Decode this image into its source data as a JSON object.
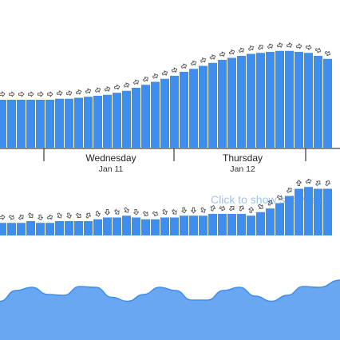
{
  "colors": {
    "bar": "#3d8eef",
    "link": "#9ec4ea",
    "arrow": "#555555",
    "axis": "#111111",
    "tide_fill": "#6aa7f2",
    "tide_line": "#3d8eef"
  },
  "icons": {
    "swell_direction": "arrow-right-icon"
  },
  "timeline": {
    "days": [
      {
        "name": "Wednesday",
        "date": "Jan 11"
      },
      {
        "name": "Thursday",
        "date": "Jan 12"
      }
    ]
  },
  "subswell_link": {
    "label": "Click to show subswells"
  },
  "chart_data": [
    {
      "type": "bar",
      "name": "primary-swell",
      "x_start": 0,
      "x_step": 1,
      "ylim": [
        0,
        120
      ],
      "values": [
        48,
        48,
        48,
        48,
        48,
        48,
        49,
        49,
        50,
        51,
        52,
        53,
        55,
        57,
        60,
        63,
        66,
        69,
        72,
        76,
        79,
        82,
        85,
        88,
        90,
        92,
        94,
        95,
        96,
        97,
        97,
        96,
        95,
        92,
        89
      ],
      "directions": [
        -8,
        -5,
        -3,
        -2,
        0,
        0,
        -12,
        -15,
        -20,
        -25,
        -28,
        -20,
        -15,
        -22,
        -30,
        -35,
        -30,
        -22,
        -18,
        -25,
        -28,
        -30,
        -25,
        -20,
        -25,
        -30,
        -35,
        -40,
        -30,
        -20,
        -15,
        -10,
        10,
        20,
        25
      ]
    },
    {
      "type": "bar",
      "name": "secondary-swell",
      "x_start": 0,
      "x_step": 1,
      "ylim": [
        0,
        40
      ],
      "values": [
        7,
        7,
        7,
        8,
        7,
        7,
        8,
        8,
        8,
        8,
        9,
        10,
        10,
        11,
        10,
        9,
        9,
        10,
        10,
        11,
        11,
        11,
        12,
        12,
        12,
        12,
        11,
        13,
        15,
        18,
        22,
        26,
        27,
        26,
        26
      ],
      "directions": [
        -10,
        30,
        -40,
        50,
        80,
        -20,
        60,
        70,
        40,
        -60,
        70,
        90,
        50,
        60,
        80,
        40,
        30,
        60,
        50,
        80,
        90,
        60,
        -70,
        20,
        -45,
        -60,
        -80,
        40,
        -60,
        30,
        -40,
        -90,
        -20,
        -50,
        -60
      ]
    },
    {
      "type": "area",
      "name": "tide",
      "ylim": [
        0,
        1
      ],
      "x": [
        0,
        20,
        40,
        60,
        80,
        100,
        120,
        140,
        160,
        180,
        200,
        220,
        240,
        260,
        280,
        300,
        320,
        340,
        360,
        380,
        400,
        426
      ],
      "values": [
        0.35,
        0.62,
        0.7,
        0.52,
        0.5,
        0.72,
        0.7,
        0.45,
        0.35,
        0.52,
        0.7,
        0.62,
        0.38,
        0.38,
        0.62,
        0.7,
        0.48,
        0.35,
        0.5,
        0.72,
        0.7,
        0.88
      ]
    }
  ]
}
